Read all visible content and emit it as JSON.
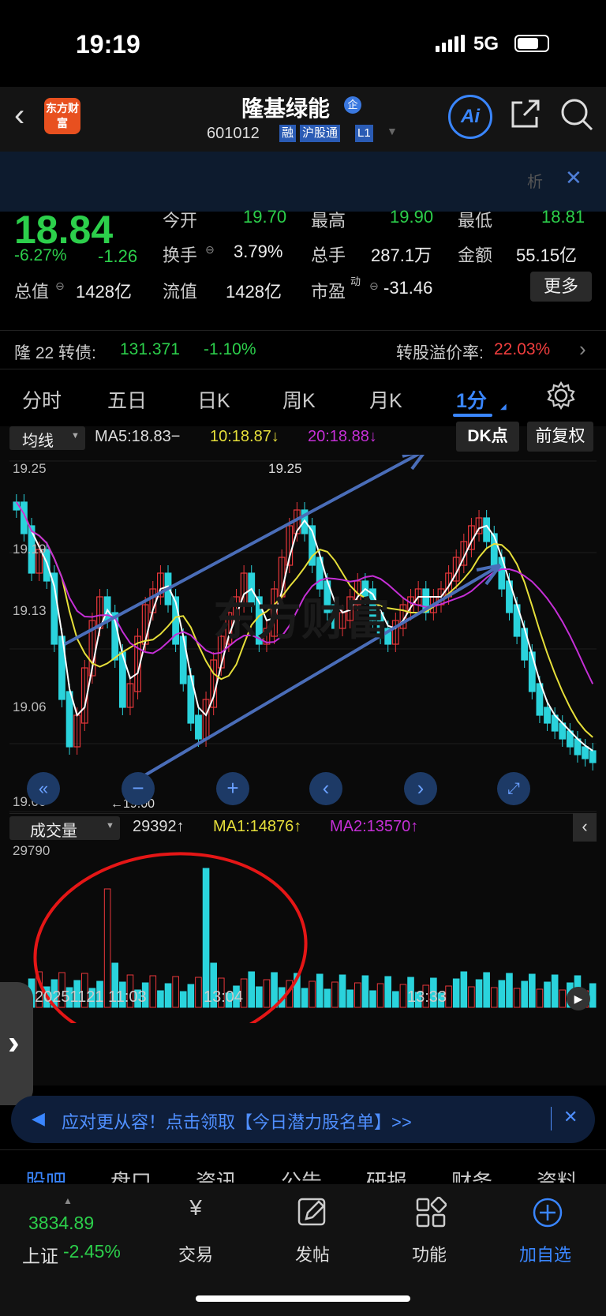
{
  "status": {
    "time": "19:19",
    "network": "5G"
  },
  "header": {
    "logo": "东方财富",
    "stock_name": "隆基绿能",
    "badge": "企",
    "code": "601012",
    "tags": [
      "融",
      "沪股通",
      "L1"
    ],
    "ai": "Ai"
  },
  "banner": {
    "text": "析",
    "close": "✕"
  },
  "quote": {
    "price": "18.84",
    "change_pct": "-6.27%",
    "change": "-1.26",
    "open_label": "今开",
    "open": "19.70",
    "high_label": "最高",
    "high": "19.90",
    "low_label": "最低",
    "low": "18.81",
    "turnover_label": "换手",
    "turnover": "3.79%",
    "volume_label": "总手",
    "volume": "287.1万",
    "amount_label": "金额",
    "amount": "55.15亿",
    "mcap_label": "总值",
    "mcap": "1428亿",
    "float_label": "流值",
    "float": "1428亿",
    "pe_label": "市盈",
    "pe_sup": "动",
    "pe": "-31.46",
    "more": "更多"
  },
  "bond": {
    "name": "隆 22 转债:",
    "price": "131.371",
    "change": "-1.10%",
    "premium_label": "转股溢价率:",
    "premium": "22.03%"
  },
  "tabs": [
    "分时",
    "五日",
    "日K",
    "周K",
    "月K",
    "1分"
  ],
  "chart": {
    "indicator": "均线",
    "ma5": "MA5:18.83−",
    "ma10": "10:18.87↓",
    "ma20": "20:18.88↓",
    "dk": "DK点",
    "adjust": "前复权",
    "y_ticks": [
      "19.25",
      "19.19",
      "19.13",
      "19.06",
      "19.00"
    ],
    "peak_label": "19.25",
    "low_label": "←19.00",
    "watermark": "东方财富",
    "vol_indicator": "成交量",
    "vol_value": "29392↑",
    "vol_ma1": "MA1:14876↑",
    "vol_ma2": "MA2:13570↑",
    "vol_max": "29790",
    "x_ticks": [
      "20251121 11:03",
      "13:04",
      "13:33"
    ],
    "colors": {
      "up": "#e8373b",
      "down": "#2ad3dc",
      "ma5": "#ffffff",
      "ma10": "#e6df3a",
      "ma20": "#c52fd6",
      "arrow": "#4a6db8",
      "circle": "#e51616"
    }
  },
  "ad": {
    "text": "应对更从容！点击领取【今日潜力股名单】>>",
    "close": "✕"
  },
  "subtabs": [
    "股吧",
    "盘口",
    "资讯",
    "公告",
    "研报",
    "财务",
    "资料"
  ],
  "nav": {
    "index_value": "3834.89",
    "index_name": "上证",
    "index_change": "-2.45%",
    "items": [
      "交易",
      "发帖",
      "功能",
      "加自选"
    ]
  }
}
